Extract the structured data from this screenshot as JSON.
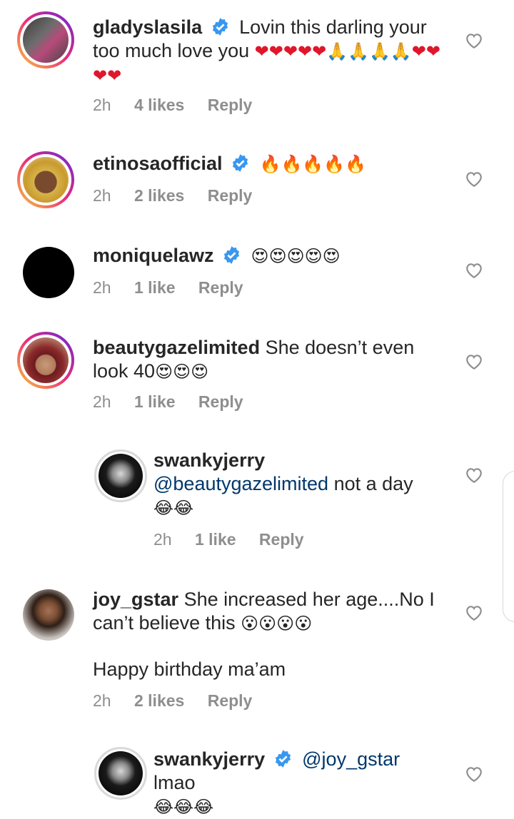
{
  "comments": [
    {
      "username": "gladyslasila",
      "text": "Lovin this darling your too much love you",
      "emojis": "❤❤❤❤❤🙏🙏🙏🙏❤❤❤❤",
      "time": "2h",
      "likes": "4 likes",
      "reply": "Reply"
    },
    {
      "username": "etinosaofficial",
      "text": "",
      "emojis": "🔥🔥🔥🔥🔥",
      "time": "2h",
      "likes": "2 likes",
      "reply": "Reply"
    },
    {
      "username": "moniquelawz",
      "text": "",
      "emojis": "😍😍😍😍😍",
      "time": "2h",
      "likes": "1 like",
      "reply": "Reply"
    },
    {
      "username": "beautygazelimited",
      "text": "She doesn’t even look 40",
      "emojis": "😍😍😍",
      "time": "2h",
      "likes": "1 like",
      "reply": "Reply"
    },
    {
      "username": "swankyjerry",
      "mention": "@beautygazelimited",
      "text": "not a day",
      "emojis": "😂😂",
      "time": "2h",
      "likes": "1 like",
      "reply": "Reply"
    },
    {
      "username": "joy_gstar",
      "text": "She increased her age....No I can’t believe this",
      "emojis": "😮😮😮😮",
      "text2": "Happy birthday ma’am",
      "time": "2h",
      "likes": "2 likes",
      "reply": "Reply"
    },
    {
      "username": "swankyjerry",
      "mention": "@joy_gstar",
      "text": "lmao",
      "emojis": "😂😂😂"
    }
  ],
  "colors": {
    "verified": "#3897f0",
    "mention": "#00376b",
    "meta": "#8e8e8e",
    "heart": "#e0162b"
  },
  "icons": {
    "like": "heart-outline-icon",
    "verified": "verified-badge-icon"
  }
}
